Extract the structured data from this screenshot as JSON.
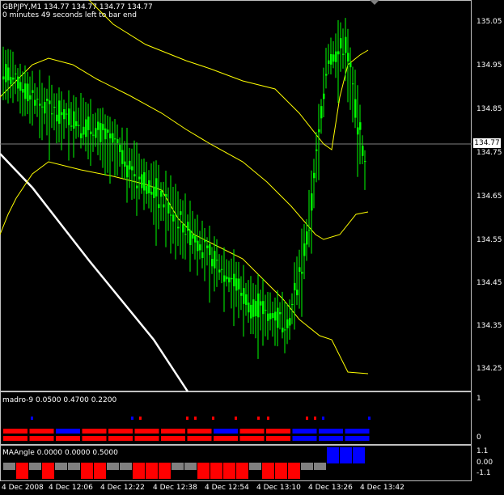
{
  "main": {
    "header_line1": "GBPJPY,M1  134.77 134.77 134.77 134.77",
    "header_line2": "0 minutes 49 seconds left to bar end",
    "current_price": "134.77",
    "y_ticks": [
      "135.05",
      "134.95",
      "134.85",
      "134.75",
      "134.65",
      "134.55",
      "134.45",
      "134.35",
      "134.25"
    ]
  },
  "sub1": {
    "label": "madro-9 0.0500 0.4700 0.2200",
    "y_ticks": [
      "1",
      "0"
    ]
  },
  "sub2": {
    "label": "MAAngle 0.0000 0.0000 0.5000",
    "y_ticks": [
      "1.1",
      "0.00",
      "-1.1"
    ]
  },
  "x_axis": {
    "labels": [
      "4 Dec 2008",
      "4 Dec 12:06",
      "4 Dec 12:22",
      "4 Dec 12:38",
      "4 Dec 12:54",
      "4 Dec 13:10",
      "4 Dec 13:26",
      "4 Dec 13:42"
    ]
  },
  "colors": {
    "candles": "#00ff00",
    "bands": "#ffff00",
    "white_line": "#ffffff",
    "red": "#ff0000",
    "blue": "#0000ff",
    "gray": "#808080"
  },
  "chart_data": {
    "type": "line",
    "title": "GBPJPY,M1",
    "ylim": [
      134.22,
      135.08
    ],
    "x": [
      "4 Dec 2008",
      "4 Dec 12:06",
      "4 Dec 12:22",
      "4 Dec 12:38",
      "4 Dec 12:54",
      "4 Dec 13:10",
      "4 Dec 13:26",
      "4 Dec 13:42"
    ],
    "series": [
      {
        "values": [
          134.94,
          134.9,
          134.86,
          134.84,
          134.82,
          134.8,
          134.76,
          134.7,
          134.66,
          134.61,
          134.56,
          134.5,
          134.46,
          134.4,
          134.38,
          134.36,
          134.56,
          134.96,
          135.0,
          134.72
        ]
      }
    ]
  }
}
